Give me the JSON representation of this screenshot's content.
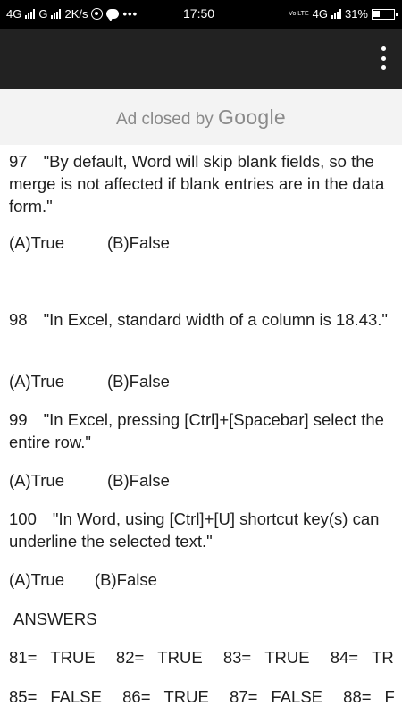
{
  "status_bar": {
    "network_1": "4G",
    "network_2": "G",
    "speed": "2K/s",
    "more": "•••",
    "time": "17:50",
    "volte": "Vo LTE",
    "network_3": "4G",
    "battery": "31%"
  },
  "ad": {
    "prefix": "Ad closed by",
    "brand": "Google"
  },
  "questions": [
    {
      "number": "97",
      "text_first": "\"By default, Word will skip blank fields, so",
      "text_rest": "the merge is not affected if blank entries are in the data form.\"",
      "option_a": "(A)True",
      "option_b": "(B)False"
    },
    {
      "number": "98",
      "text_first": "\"In Excel, standard width of a column is",
      "text_rest": "18.43.\"",
      "option_a": "(A)True",
      "option_b": "(B)False"
    },
    {
      "number": "99",
      "text_first": "\"In Excel, pressing [Ctrl]+[Spacebar] select",
      "text_rest": "the entire row.\"",
      "option_a": "(A)True",
      "option_b": "(B)False"
    },
    {
      "number": "100",
      "text_first": "\"In Word, using [Ctrl]+[U] shortcut key(s)",
      "text_rest": "can underline the selected text.\"",
      "option_a": "(A)True",
      "option_b": "(B)False"
    }
  ],
  "answers": {
    "heading": "ANSWERS",
    "rows": [
      [
        {
          "num": "81=",
          "val": "TRUE"
        },
        {
          "num": "82=",
          "val": "TRUE"
        },
        {
          "num": "83=",
          "val": "TRUE"
        },
        {
          "num": "84=",
          "val": "TR"
        }
      ],
      [
        {
          "num": "85=",
          "val": "FALSE"
        },
        {
          "num": "86=",
          "val": "TRUE"
        },
        {
          "num": "87=",
          "val": "FALSE"
        },
        {
          "num": "88=",
          "val": "F"
        }
      ]
    ]
  }
}
